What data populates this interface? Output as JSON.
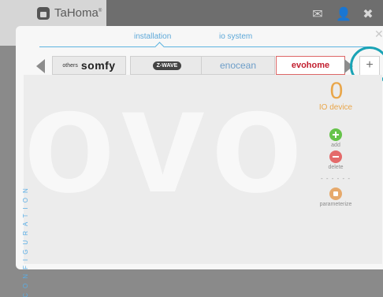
{
  "header": {
    "app_name": "TaHoma",
    "trademark": "®",
    "icons": [
      "mail-icon",
      "user-icon",
      "close-icon"
    ]
  },
  "dialog": {
    "tabs": [
      {
        "label": "installation",
        "active": true
      },
      {
        "label": "io system",
        "active": false
      }
    ],
    "close_icon": "close-icon"
  },
  "protocols": [
    {
      "id": "somfy",
      "small": "others",
      "big": "somfy"
    },
    {
      "id": "zwave",
      "label": "Z-WAVE"
    },
    {
      "id": "enocean",
      "label": "enocean"
    },
    {
      "id": "evohome",
      "label": "evohome",
      "active": true
    }
  ],
  "add_protocol": "+",
  "side_label": "CONFIGURATION",
  "watermark": "ovo",
  "device_summary": {
    "count": "0",
    "label": "IO device"
  },
  "actions": {
    "add": "add",
    "delete": "delete",
    "divider": "- - - - - -",
    "parameterize": "parameterize"
  },
  "colors": {
    "accent": "#5db4e0",
    "orange": "#e9a64a",
    "green": "#66c34a",
    "red": "#e46a6a",
    "highlight_ring": "#1aa3b5"
  }
}
